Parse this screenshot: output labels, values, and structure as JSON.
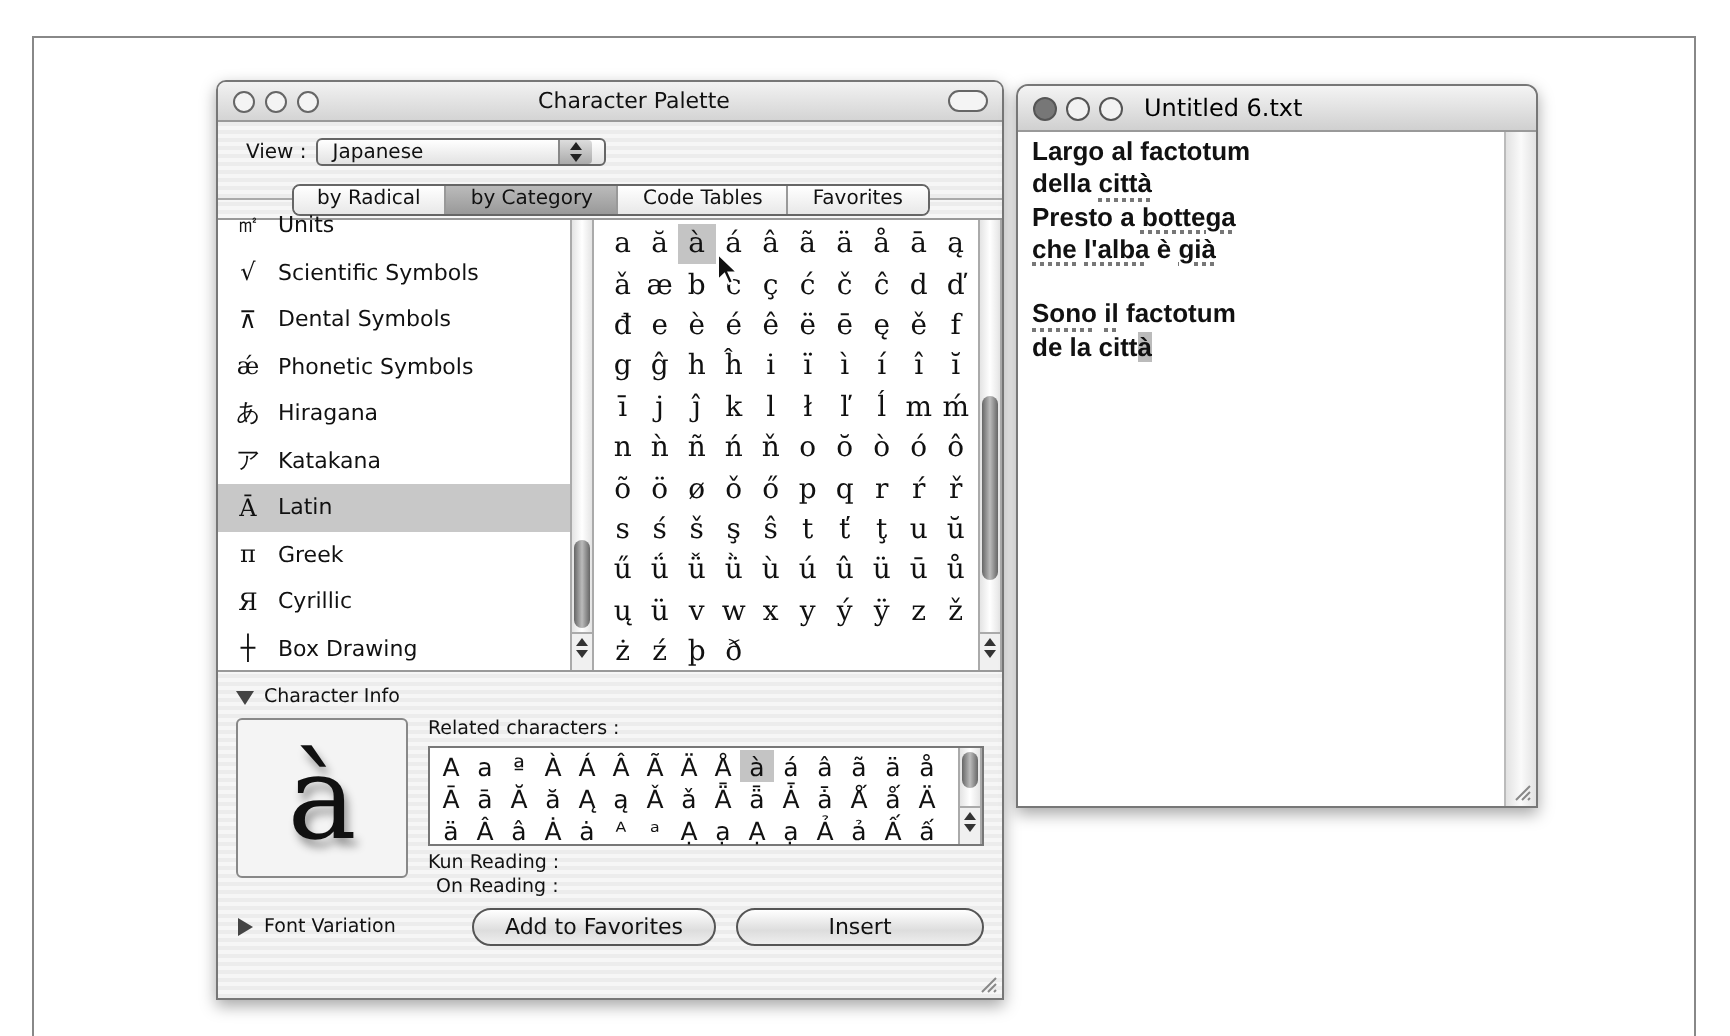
{
  "palette": {
    "title": "Character Palette",
    "view_label": "View :",
    "view_value": "Japanese",
    "tabs": [
      {
        "label": "by Radical",
        "selected": false
      },
      {
        "label": "by Category",
        "selected": true
      },
      {
        "label": "Code Tables",
        "selected": false
      },
      {
        "label": "Favorites",
        "selected": false
      }
    ],
    "categories": [
      {
        "glyph": "㎡",
        "label": "Units",
        "selected": false
      },
      {
        "glyph": "√",
        "label": "Scientific Symbols",
        "selected": false
      },
      {
        "glyph": "⊼",
        "label": "Dental Symbols",
        "selected": false
      },
      {
        "glyph": "ǽ",
        "label": "Phonetic Symbols",
        "selected": false
      },
      {
        "glyph": "あ",
        "label": "Hiragana",
        "selected": false
      },
      {
        "glyph": "ア",
        "label": "Katakana",
        "selected": false
      },
      {
        "glyph": "Ā",
        "label": "Latin",
        "selected": true
      },
      {
        "glyph": "π",
        "label": "Greek",
        "selected": false
      },
      {
        "glyph": "Я",
        "label": "Cyrillic",
        "selected": false
      },
      {
        "glyph": "┼",
        "label": "Box Drawing",
        "selected": false
      }
    ],
    "grid": [
      [
        {
          "char": "a",
          "selected": false
        },
        {
          "char": "ă",
          "selected": false
        },
        {
          "char": "à",
          "selected": true
        },
        {
          "char": "á",
          "selected": false
        },
        {
          "char": "â",
          "selected": false
        },
        {
          "char": "ã",
          "selected": false
        },
        {
          "char": "ä",
          "selected": false
        },
        {
          "char": "å",
          "selected": false
        },
        {
          "char": "ā",
          "selected": false
        },
        {
          "char": "ą",
          "selected": false
        }
      ],
      [
        {
          "char": "ǎ",
          "selected": false
        },
        {
          "char": "æ",
          "selected": false
        },
        {
          "char": "b",
          "selected": false
        },
        {
          "char": "c",
          "selected": false
        },
        {
          "char": "ç",
          "selected": false
        },
        {
          "char": "ć",
          "selected": false
        },
        {
          "char": "č",
          "selected": false
        },
        {
          "char": "ĉ",
          "selected": false
        },
        {
          "char": "d",
          "selected": false
        },
        {
          "char": "ď",
          "selected": false
        }
      ],
      [
        {
          "char": "đ",
          "selected": false
        },
        {
          "char": "e",
          "selected": false
        },
        {
          "char": "è",
          "selected": false
        },
        {
          "char": "é",
          "selected": false
        },
        {
          "char": "ê",
          "selected": false
        },
        {
          "char": "ë",
          "selected": false
        },
        {
          "char": "ē",
          "selected": false
        },
        {
          "char": "ę",
          "selected": false
        },
        {
          "char": "ě",
          "selected": false
        },
        {
          "char": "f",
          "selected": false
        }
      ],
      [
        {
          "char": "g",
          "selected": false
        },
        {
          "char": "ĝ",
          "selected": false
        },
        {
          "char": "h",
          "selected": false
        },
        {
          "char": "ĥ",
          "selected": false
        },
        {
          "char": "i",
          "selected": false
        },
        {
          "char": "ï",
          "selected": false
        },
        {
          "char": "ì",
          "selected": false
        },
        {
          "char": "í",
          "selected": false
        },
        {
          "char": "î",
          "selected": false
        },
        {
          "char": "ĭ",
          "selected": false
        }
      ],
      [
        {
          "char": "ī",
          "selected": false
        },
        {
          "char": "j",
          "selected": false
        },
        {
          "char": "ĵ",
          "selected": false
        },
        {
          "char": "k",
          "selected": false
        },
        {
          "char": "l",
          "selected": false
        },
        {
          "char": "ł",
          "selected": false
        },
        {
          "char": "ľ",
          "selected": false
        },
        {
          "char": "ĺ",
          "selected": false
        },
        {
          "char": "m",
          "selected": false
        },
        {
          "char": "ḿ",
          "selected": false
        }
      ],
      [
        {
          "char": "n",
          "selected": false
        },
        {
          "char": "ǹ",
          "selected": false
        },
        {
          "char": "ñ",
          "selected": false
        },
        {
          "char": "ń",
          "selected": false
        },
        {
          "char": "ň",
          "selected": false
        },
        {
          "char": "o",
          "selected": false
        },
        {
          "char": "ŏ",
          "selected": false
        },
        {
          "char": "ò",
          "selected": false
        },
        {
          "char": "ó",
          "selected": false
        },
        {
          "char": "ô",
          "selected": false
        }
      ],
      [
        {
          "char": "õ",
          "selected": false
        },
        {
          "char": "ö",
          "selected": false
        },
        {
          "char": "ø",
          "selected": false
        },
        {
          "char": "ǒ",
          "selected": false
        },
        {
          "char": "ő",
          "selected": false
        },
        {
          "char": "p",
          "selected": false
        },
        {
          "char": "q",
          "selected": false
        },
        {
          "char": "r",
          "selected": false
        },
        {
          "char": "ŕ",
          "selected": false
        },
        {
          "char": "ř",
          "selected": false
        }
      ],
      [
        {
          "char": "s",
          "selected": false
        },
        {
          "char": "ś",
          "selected": false
        },
        {
          "char": "š",
          "selected": false
        },
        {
          "char": "ş",
          "selected": false
        },
        {
          "char": "ŝ",
          "selected": false
        },
        {
          "char": "t",
          "selected": false
        },
        {
          "char": "ť",
          "selected": false
        },
        {
          "char": "ţ",
          "selected": false
        },
        {
          "char": "u",
          "selected": false
        },
        {
          "char": "ŭ",
          "selected": false
        }
      ],
      [
        {
          "char": "ű",
          "selected": false
        },
        {
          "char": "ǘ",
          "selected": false
        },
        {
          "char": "ǚ",
          "selected": false
        },
        {
          "char": "ǜ",
          "selected": false
        },
        {
          "char": "ù",
          "selected": false
        },
        {
          "char": "ú",
          "selected": false
        },
        {
          "char": "û",
          "selected": false
        },
        {
          "char": "ü",
          "selected": false
        },
        {
          "char": "ū",
          "selected": false
        },
        {
          "char": "ů",
          "selected": false
        }
      ],
      [
        {
          "char": "ų",
          "selected": false
        },
        {
          "char": "ü",
          "selected": false
        },
        {
          "char": "v",
          "selected": false
        },
        {
          "char": "w",
          "selected": false
        },
        {
          "char": "x",
          "selected": false
        },
        {
          "char": "y",
          "selected": false
        },
        {
          "char": "ý",
          "selected": false
        },
        {
          "char": "ÿ",
          "selected": false
        },
        {
          "char": "z",
          "selected": false
        },
        {
          "char": "ž",
          "selected": false
        }
      ],
      [
        {
          "char": "ż",
          "selected": false
        },
        {
          "char": "ź",
          "selected": false
        },
        {
          "char": "þ",
          "selected": false
        },
        {
          "char": "ð",
          "selected": false
        }
      ]
    ],
    "character_info": {
      "label": "Character Info",
      "expanded": true,
      "preview": "à",
      "related_label": "Related characters :",
      "related": [
        [
          {
            "char": "A",
            "selected": false
          },
          {
            "char": "a",
            "selected": false
          },
          {
            "char": "ª",
            "selected": false
          },
          {
            "char": "À",
            "selected": false
          },
          {
            "char": "Á",
            "selected": false
          },
          {
            "char": "Â",
            "selected": false
          },
          {
            "char": "Ã",
            "selected": false
          },
          {
            "char": "Ä",
            "selected": false
          },
          {
            "char": "Å",
            "selected": false
          },
          {
            "char": "à",
            "selected": true
          },
          {
            "char": "á",
            "selected": false
          },
          {
            "char": "â",
            "selected": false
          },
          {
            "char": "ã",
            "selected": false
          },
          {
            "char": "ä",
            "selected": false
          },
          {
            "char": "å",
            "selected": false
          }
        ],
        [
          {
            "char": "Ā",
            "selected": false
          },
          {
            "char": "ā",
            "selected": false
          },
          {
            "char": "Ă",
            "selected": false
          },
          {
            "char": "ă",
            "selected": false
          },
          {
            "char": "Ą",
            "selected": false
          },
          {
            "char": "ą",
            "selected": false
          },
          {
            "char": "Ǎ",
            "selected": false
          },
          {
            "char": "ǎ",
            "selected": false
          },
          {
            "char": "Ǟ",
            "selected": false
          },
          {
            "char": "ǟ",
            "selected": false
          },
          {
            "char": "Ǡ",
            "selected": false
          },
          {
            "char": "ǡ",
            "selected": false
          },
          {
            "char": "Ǻ",
            "selected": false
          },
          {
            "char": "ǻ",
            "selected": false
          },
          {
            "char": "Ä",
            "selected": false
          }
        ],
        [
          {
            "char": "ä",
            "selected": false
          },
          {
            "char": "Â",
            "selected": false
          },
          {
            "char": "â",
            "selected": false
          },
          {
            "char": "Ȧ",
            "selected": false
          },
          {
            "char": "ȧ",
            "selected": false
          },
          {
            "char": "ᴬ",
            "selected": false
          },
          {
            "char": "ᵃ",
            "selected": false
          },
          {
            "char": "Ạ",
            "selected": false
          },
          {
            "char": "ạ",
            "selected": false
          },
          {
            "char": "Ạ",
            "selected": false
          },
          {
            "char": "ạ",
            "selected": false
          },
          {
            "char": "Ả",
            "selected": false
          },
          {
            "char": "ả",
            "selected": false
          },
          {
            "char": "Ấ",
            "selected": false
          },
          {
            "char": "ấ",
            "selected": false
          }
        ]
      ],
      "kun_reading": "Kun Reading :",
      "on_reading": "On Reading :"
    },
    "font_variation": {
      "label": "Font Variation",
      "expanded": false
    },
    "buttons": [
      "Add to Favorites",
      "Insert"
    ]
  },
  "editor": {
    "title": "Untitled 6.txt",
    "lines": [
      {
        "gap_before": false,
        "segments": [
          {
            "text": "Largo al factotum",
            "misspelled": false,
            "highlighted": false
          }
        ]
      },
      {
        "gap_before": false,
        "segments": [
          {
            "text": "della ",
            "misspelled": false,
            "highlighted": false
          },
          {
            "text": "città",
            "misspelled": true,
            "highlighted": false
          }
        ]
      },
      {
        "gap_before": false,
        "segments": [
          {
            "text": "Presto a ",
            "misspelled": false,
            "highlighted": false
          },
          {
            "text": "bottega",
            "misspelled": true,
            "highlighted": false
          }
        ]
      },
      {
        "gap_before": false,
        "segments": [
          {
            "text": "che ",
            "misspelled": true,
            "highlighted": false
          },
          {
            "text": "l'alba",
            "misspelled": true,
            "highlighted": false
          },
          {
            "text": " è ",
            "misspelled": false,
            "highlighted": false
          },
          {
            "text": "già",
            "misspelled": true,
            "highlighted": false
          }
        ]
      },
      {
        "gap_before": true,
        "segments": [
          {
            "text": "Sono ",
            "misspelled": true,
            "highlighted": false
          },
          {
            "text": "il",
            "misspelled": true,
            "highlighted": false
          },
          {
            "text": " factotum",
            "misspelled": false,
            "highlighted": false
          }
        ]
      },
      {
        "gap_before": false,
        "segments": [
          {
            "text": "de la citt",
            "misspelled": false,
            "highlighted": false
          },
          {
            "text": "à",
            "misspelled": false,
            "highlighted": true
          }
        ]
      }
    ]
  }
}
